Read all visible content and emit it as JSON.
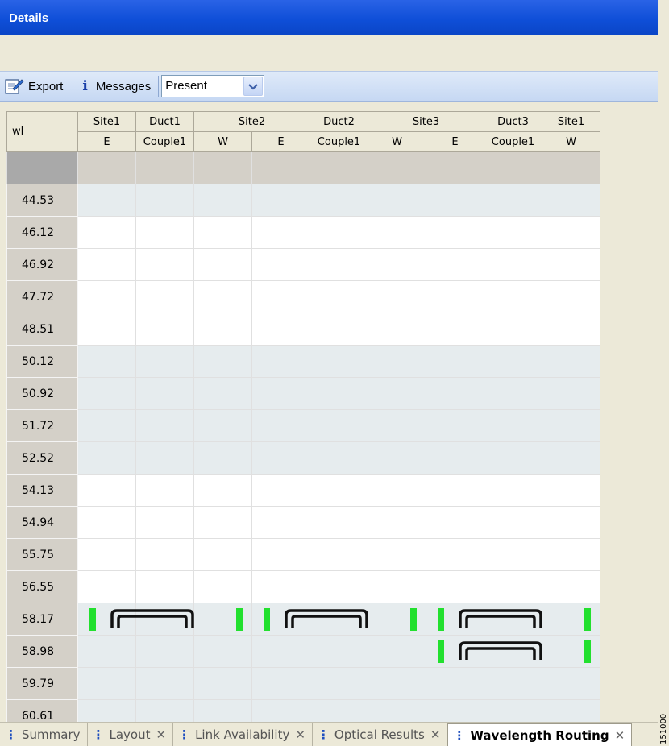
{
  "title": "Details",
  "toolbar": {
    "export_label": "Export",
    "messages_label": "Messages",
    "filter_value": "Present",
    "export_icon": "export-icon",
    "info_icon": "info-icon"
  },
  "grid": {
    "corner_label": "wl",
    "header_groups": [
      {
        "label": "Site1",
        "span": 1
      },
      {
        "label": "Duct1",
        "span": 1
      },
      {
        "label": "Site2",
        "span": 2
      },
      {
        "label": "Duct2",
        "span": 1
      },
      {
        "label": "Site3",
        "span": 2
      },
      {
        "label": "Duct3",
        "span": 1
      },
      {
        "label": "Site1",
        "span": 1
      }
    ],
    "subheaders": [
      "E",
      "Couple1",
      "W",
      "E",
      "Couple1",
      "W",
      "E",
      "Couple1",
      "W"
    ],
    "rows": [
      {
        "wl": "44.53",
        "style": "shade"
      },
      {
        "wl": "46.12",
        "style": "white"
      },
      {
        "wl": "46.92",
        "style": "white"
      },
      {
        "wl": "47.72",
        "style": "white"
      },
      {
        "wl": "48.51",
        "style": "white"
      },
      {
        "wl": "50.12",
        "style": "shade"
      },
      {
        "wl": "50.92",
        "style": "shade"
      },
      {
        "wl": "51.72",
        "style": "shade"
      },
      {
        "wl": "52.52",
        "style": "shade"
      },
      {
        "wl": "54.13",
        "style": "white"
      },
      {
        "wl": "54.94",
        "style": "white"
      },
      {
        "wl": "55.75",
        "style": "white"
      },
      {
        "wl": "56.55",
        "style": "white"
      },
      {
        "wl": "58.17",
        "style": "route",
        "routes": [
          {
            "from_col": 0,
            "to_col": 2
          },
          {
            "from_col": 3,
            "to_col": 5
          },
          {
            "from_col": 6,
            "to_col": 8
          }
        ]
      },
      {
        "wl": "58.98",
        "style": "route",
        "routes": [
          {
            "from_col": 6,
            "to_col": 8
          }
        ]
      },
      {
        "wl": "59.79",
        "style": "shade"
      },
      {
        "wl": "60.61",
        "style": "shade"
      }
    ],
    "route_color": "#22e02e"
  },
  "tabs": [
    {
      "label": "Summary",
      "closable": false,
      "active": false
    },
    {
      "label": "Layout",
      "closable": true,
      "active": false
    },
    {
      "label": "Link Availability",
      "closable": true,
      "active": false
    },
    {
      "label": "Optical Results",
      "closable": true,
      "active": false
    },
    {
      "label": "Wavelength Routing",
      "closable": true,
      "active": true
    }
  ],
  "side_code": "151000"
}
